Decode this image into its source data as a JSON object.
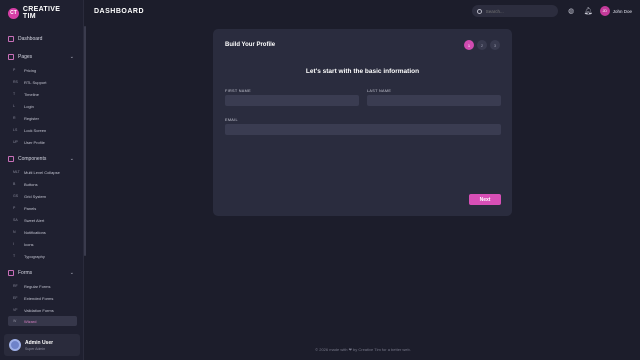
{
  "brand": {
    "logo": "CT",
    "name": "CREATIVE TIM"
  },
  "sidebar": {
    "dashboard": "Dashboard",
    "pages": {
      "label": "Pages",
      "items": [
        {
          "ab": "P",
          "label": "Pricing"
        },
        {
          "ab": "RS",
          "label": "RTL Support"
        },
        {
          "ab": "T",
          "label": "Timeline"
        },
        {
          "ab": "L",
          "label": "Login"
        },
        {
          "ab": "R",
          "label": "Register"
        },
        {
          "ab": "LS",
          "label": "Lock Screen"
        },
        {
          "ab": "UP",
          "label": "User Profile"
        }
      ]
    },
    "components": {
      "label": "Components",
      "items": [
        {
          "ab": "MLT",
          "label": "Multi Level Collapse"
        },
        {
          "ab": "B",
          "label": "Buttons"
        },
        {
          "ab": "GS",
          "label": "Grid System"
        },
        {
          "ab": "P",
          "label": "Panels"
        },
        {
          "ab": "SA",
          "label": "Sweet Alert"
        },
        {
          "ab": "N",
          "label": "Notifications"
        },
        {
          "ab": "I",
          "label": "Icons"
        },
        {
          "ab": "T",
          "label": "Typography"
        }
      ]
    },
    "forms": {
      "label": "Forms",
      "items": [
        {
          "ab": "RF",
          "label": "Regular Forms"
        },
        {
          "ab": "EF",
          "label": "Extended Forms"
        },
        {
          "ab": "VF",
          "label": "Validation Forms"
        },
        {
          "ab": "W",
          "label": "Wizard"
        }
      ]
    },
    "user": {
      "name": "Admin User",
      "role": "Super Admin"
    }
  },
  "header": {
    "title": "DASHBOARD",
    "search_placeholder": "Search...",
    "avatar_initials": "JD",
    "user_name": "John Doe"
  },
  "wizard": {
    "title": "Build Your Profile",
    "steps": [
      "1",
      "2",
      "3"
    ],
    "active_step": 1,
    "subtitle": "Let's start with the basic information",
    "first_name_label": "FIRST NAME",
    "last_name_label": "LAST NAME",
    "email_label": "EMAIL",
    "first_name_value": "",
    "last_name_value": "",
    "email_value": "",
    "next_label": "Next"
  },
  "footer": "© 2026 made with ❤ by Creative Tim for a better web.",
  "colors": {
    "accent": "#d74fb6",
    "background": "#1c1d2b",
    "card": "#2a2c3e"
  }
}
